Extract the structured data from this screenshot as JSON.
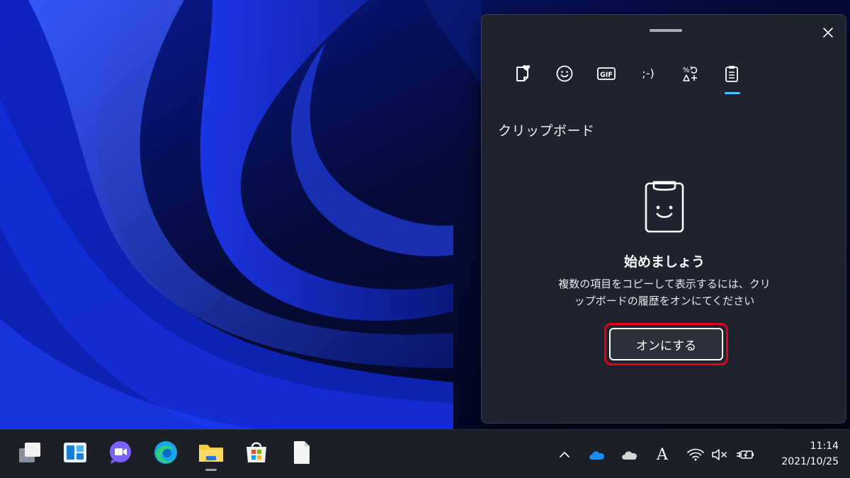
{
  "panel": {
    "tabs": [
      {
        "name": "favorites",
        "icon": "heart-note-icon"
      },
      {
        "name": "emoji",
        "icon": "smiley-icon"
      },
      {
        "name": "gif",
        "icon": "gif-icon",
        "label": "GIF"
      },
      {
        "name": "kaomoji",
        "icon": "kaomoji-icon",
        "label": ";-)"
      },
      {
        "name": "symbols",
        "icon": "symbols-icon"
      },
      {
        "name": "clipboard",
        "icon": "clipboard-icon",
        "active": true
      }
    ],
    "section_title": "クリップボード",
    "empty_title": "始めましょう",
    "empty_desc_line1": "複数の項目をコピーして表示するには、クリ",
    "empty_desc_line2": "ップボードの履歴をオンにてください",
    "turn_on_label": "オンにする",
    "accent": "#4cc2ff",
    "highlight_color": "#e2001a"
  },
  "taskbar": {
    "apps": [
      "task-view",
      "widgets",
      "teams-chat",
      "edge",
      "file-explorer",
      "microsoft-store",
      "notepad"
    ],
    "tray_icons": [
      "chevron-up-icon",
      "onedrive-icon",
      "onedrive-personal-icon",
      "ime-icon",
      "wifi-icon",
      "speaker-muted-icon",
      "battery-charging-icon"
    ],
    "ime_label": "A",
    "time": "11:14",
    "date": "2021/10/25"
  }
}
